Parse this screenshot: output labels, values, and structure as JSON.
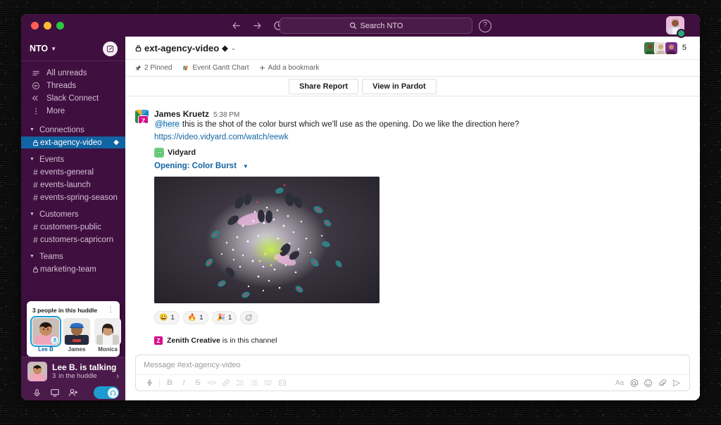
{
  "window": {
    "traffic_lights": [
      "close",
      "minimize",
      "maximize"
    ]
  },
  "topbar": {
    "back_icon": "arrow-left-icon",
    "forward_icon": "arrow-right-icon",
    "history_icon": "clock-icon",
    "search_placeholder": "Search NTO",
    "search_icon": "search-icon",
    "help_label": "?",
    "help_icon": "help-icon"
  },
  "sidebar": {
    "workspace_name": "NTO",
    "compose_icon": "compose-icon",
    "nav": [
      {
        "label": "All unreads",
        "icon": "unreads-icon"
      },
      {
        "label": "Threads",
        "icon": "threads-icon"
      },
      {
        "label": "Slack Connect",
        "icon": "slack-connect-icon"
      },
      {
        "label": "More",
        "icon": "more-icon"
      }
    ],
    "sections": [
      {
        "title": "Connections",
        "channels": [
          {
            "name": "ext-agency-video",
            "type": "private",
            "active": true,
            "badge": "external"
          }
        ]
      },
      {
        "title": "Events",
        "channels": [
          {
            "name": "events-general",
            "type": "public",
            "active": false
          },
          {
            "name": "events-launch",
            "type": "public",
            "active": false
          },
          {
            "name": "events-spring-season",
            "type": "public",
            "active": false
          }
        ]
      },
      {
        "title": "Customers",
        "channels": [
          {
            "name": "customers-public",
            "type": "public",
            "active": false
          },
          {
            "name": "customers-capricorn",
            "type": "public",
            "active": false
          }
        ]
      },
      {
        "title": "Teams",
        "channels": [
          {
            "name": "marketing-team",
            "type": "private",
            "active": false
          }
        ]
      }
    ]
  },
  "huddle_card": {
    "title": "3 people in this huddle",
    "kebab_icon": "kebab-menu-icon",
    "people": [
      {
        "name": "Lee B",
        "speaking": true
      },
      {
        "name": "James",
        "speaking": false
      },
      {
        "name": "Monica",
        "speaking": false
      }
    ]
  },
  "huddle_bar": {
    "talking_text": "Lee B. is talking",
    "count": "3",
    "sub_text": "in the huddle",
    "chevron_icon": "chevron-right-icon",
    "controls": [
      {
        "icon": "microphone-icon",
        "name": "mic-toggle"
      },
      {
        "icon": "screen-share-icon",
        "name": "screen-share"
      },
      {
        "icon": "invite-person-icon",
        "name": "invite-people"
      }
    ],
    "toggle_on": true,
    "toggle_icon": "headphones-icon"
  },
  "channel": {
    "name": "ext-agency-video",
    "lock_icon": "lock-icon",
    "external_icon": "external-connection-icon",
    "chevron_icon": "chevron-down-icon",
    "member_count": "5"
  },
  "bookmarks": [
    {
      "label": "2 Pinned",
      "icon": "pin-icon"
    },
    {
      "label": "Event Gantt Chart",
      "icon": "salesforce-icon"
    },
    {
      "label": "Add a bookmark",
      "icon": "plus-icon"
    }
  ],
  "action_buttons": [
    {
      "label": "Share Report"
    },
    {
      "label": "View in Pardot"
    }
  ],
  "message": {
    "author": "James Kruetz",
    "timestamp": "5:38 PM",
    "mention": "@here",
    "text": " this is the shot of the color burst which we'll use as the opening. Do we like the direction here?",
    "link": "https://video.vidyard.com/watch/eewk",
    "app_name": "Vidyard",
    "app_icon": "vidyard-icon",
    "video_title": "Opening: Color Burst",
    "video_caret_icon": "caret-down-icon",
    "thumbnail_alt": "color burst particle explosion"
  },
  "reactions": [
    {
      "emoji": "😀",
      "name": "grinning-face",
      "count": "1"
    },
    {
      "emoji": "🔥",
      "name": "fire",
      "count": "1"
    },
    {
      "emoji": "🎉",
      "name": "party-popper",
      "count": "1"
    },
    {
      "emoji": "☺",
      "name": "add-reaction",
      "count": ""
    }
  ],
  "join_notice": {
    "name": "Zenith Creative",
    "text": " is in this channel",
    "icon_letter": "Z"
  },
  "composer": {
    "placeholder": "Message #ext-agency-video",
    "tools_left": [
      {
        "icon": "lightning-bolt-icon",
        "name": "shortcuts"
      },
      {
        "icon": "bold-icon",
        "name": "bold",
        "label": "B"
      },
      {
        "icon": "italic-icon",
        "name": "italic",
        "label": "I"
      },
      {
        "icon": "strikethrough-icon",
        "name": "strikethrough",
        "label": "S"
      },
      {
        "icon": "code-icon",
        "name": "code",
        "label": "</>"
      },
      {
        "icon": "link-icon",
        "name": "link"
      },
      {
        "icon": "ordered-list-icon",
        "name": "ordered-list"
      },
      {
        "icon": "bulleted-list-icon",
        "name": "bulleted-list"
      },
      {
        "icon": "blockquote-icon",
        "name": "blockquote"
      },
      {
        "icon": "code-block-icon",
        "name": "code-block"
      }
    ],
    "tools_right": [
      {
        "icon": "format-icon",
        "name": "formatting",
        "label": "Aa"
      },
      {
        "icon": "mention-icon",
        "name": "mention",
        "label": "@"
      },
      {
        "icon": "emoji-icon",
        "name": "emoji"
      },
      {
        "icon": "attachment-icon",
        "name": "attach-file"
      },
      {
        "icon": "send-icon",
        "name": "send-message"
      }
    ]
  },
  "colors": {
    "sidebar_bg": "#3f0f3f",
    "active_channel": "#1164a3",
    "link": "#1264a3",
    "accent_toggle": "#1d9bd1",
    "badge_magenta": "#d5108a"
  }
}
